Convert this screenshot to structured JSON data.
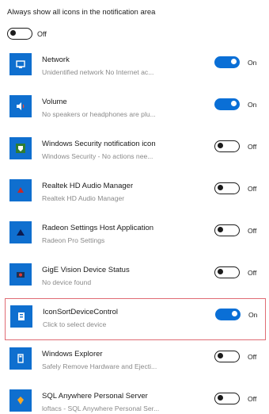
{
  "header": {
    "text": "Always show all icons in the notification area"
  },
  "master_toggle": {
    "state": "off",
    "label": "Off"
  },
  "items": [
    {
      "title": "Network",
      "subtitle": "Unidentified network No Internet ac...",
      "state": "on",
      "state_label": "On",
      "icon": "network-icon",
      "icon_color": "#0f6fcf"
    },
    {
      "title": "Volume",
      "subtitle": "No speakers or headphones are plu...",
      "state": "on",
      "state_label": "On",
      "icon": "speaker-icon",
      "icon_color": "#0f6fcf"
    },
    {
      "title": "Windows Security notification icon",
      "subtitle": "Windows Security - No actions nee...",
      "state": "off",
      "state_label": "Off",
      "icon": "shield-icon",
      "icon_color": "#0f6fcf"
    },
    {
      "title": "Realtek HD Audio Manager",
      "subtitle": "Realtek HD Audio Manager",
      "state": "off",
      "state_label": "Off",
      "icon": "audio-manager-icon",
      "icon_color": "#0f6fcf"
    },
    {
      "title": "Radeon Settings Host Application",
      "subtitle": "Radeon Pro Settings",
      "state": "off",
      "state_label": "Off",
      "icon": "radeon-icon",
      "icon_color": "#0f6fcf"
    },
    {
      "title": "GigE Vision Device Status",
      "subtitle": "No device found",
      "state": "off",
      "state_label": "Off",
      "icon": "camera-device-icon",
      "icon_color": "#0f6fcf"
    },
    {
      "title": "IconSortDeviceControl",
      "subtitle": "Click to select device",
      "state": "on",
      "state_label": "On",
      "icon": "device-control-icon",
      "icon_color": "#0f6fcf",
      "selected": true
    },
    {
      "title": "Windows Explorer",
      "subtitle": "Safely Remove Hardware and Ejecti...",
      "state": "off",
      "state_label": "Off",
      "icon": "usb-drive-icon",
      "icon_color": "#0f6fcf"
    },
    {
      "title": "SQL Anywhere Personal Server",
      "subtitle": "loftacs - SQL Anywhere Personal Ser...",
      "state": "off",
      "state_label": "Off",
      "icon": "database-icon",
      "icon_color": "#0f6fcf"
    }
  ],
  "colors": {
    "accent": "#0a6fd6",
    "selection_border": "#e06c74",
    "subtitle": "#8a8a8a"
  }
}
